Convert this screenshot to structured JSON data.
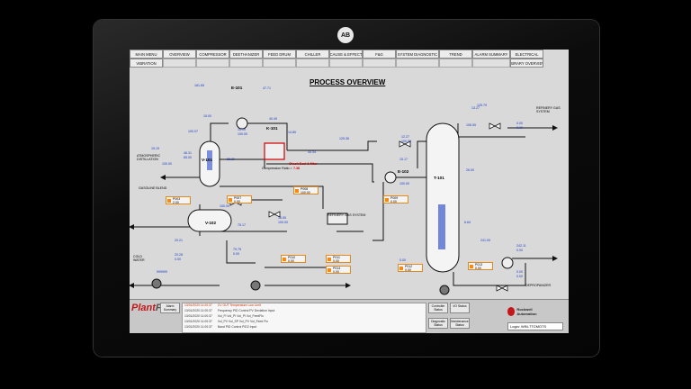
{
  "device": {
    "brand_logo_text": "AB"
  },
  "nav": {
    "row1": [
      "MAIN MENU",
      "OVERVIEW",
      "COMPRESSOR",
      "DEETHANIZER",
      "FEED DRUM",
      "CHILLER",
      "CAUSE & EFFECT",
      "F&G",
      "SYSTEM DIAGNOSTIC",
      "TREND",
      "ALARM SUMMARY",
      "ELECTRICAL"
    ],
    "row2_left": "VIBRATION",
    "row2_right": "LIBRARY OVERVIEW"
  },
  "page_title": "PROCESS OVERVIEW",
  "equipment": {
    "e101": "E-101",
    "k101": "K-101",
    "v101": "V-101",
    "v102": "V-102",
    "e102": "E-102",
    "t101": "T-101"
  },
  "streams": {
    "atmospheric": "ATMOSPHERIC DISTILLATION",
    "gasoline": "GASOLINE BLEND",
    "refinery_gas_top": "REFINERY GAS SYSTEM",
    "refinery_gas_mid": "REFINERY GAS SYSTEM",
    "cold_water": "COLD WATER",
    "depropanizer": "DEPROPANIZER"
  },
  "compressor": {
    "check_seal": "Check Seal & filter",
    "ratio_label": "Compression Ratio =",
    "ratio_value": "7.38"
  },
  "values": {
    "ti_top": "181.65",
    "tt_e101": "47.71",
    "pi_left": "15.00",
    "ti_left2": "100.07",
    "pv_v101": "10.19",
    "cv_v101": "100.00",
    "fi_k101": "40.49",
    "pt_k101": "14.85",
    "fi_atm": "15.19",
    "ti_atm": "100.00",
    "fi_flow": "125.36",
    "ti_flow2": "44.34",
    "lt_v101": "65.29",
    "pv_lic": "46.31",
    "cv_lic": "65.00",
    "pv_t101a": "12.27",
    "cv_t101a": "100.00",
    "ti_t101": "106.55",
    "pi_t101": "15.17",
    "pv_t101b": "100.00",
    "ti_t101c": "26.00",
    "ri_top1": "13.27",
    "ri_top2": "125.79",
    "pv_top": "0.00",
    "cv_top": "0.00",
    "v102_temp": "20.21",
    "pv_v102": "20.28",
    "cv_v102": "0.00",
    "pv_mid": "16.55",
    "cv_mid": "100.00",
    "li_mid": "75.17",
    "pv_e102": "79.75",
    "cv_e102": "0.00",
    "cw_flow": "999999",
    "lt_t101": "6.64",
    "ti_bot": "241.00",
    "pv_bot": "242.11",
    "cv_bot": "0.00",
    "pi_bot": "0.00",
    "ti_bot2": "0.00",
    "tt_v102": "100.00",
    "pv_pump": "0.00",
    "cv_pump": "0.00"
  },
  "alarm_boxes": [
    {
      "tag": "P003",
      "val": "2.00"
    },
    {
      "tag": "P007",
      "val": "0.00"
    },
    {
      "tag": "P008",
      "val": "100.00"
    },
    {
      "tag": "P009",
      "val": "0.00"
    },
    {
      "tag": "P010",
      "val": "0.00"
    },
    {
      "tag": "P011",
      "val": "0.00"
    },
    {
      "tag": "P012",
      "val": "0.00"
    },
    {
      "tag": "P013",
      "val": "0.00"
    },
    {
      "tag": "P014",
      "val": "0.00"
    }
  ],
  "bottom": {
    "brand": "Plant",
    "brand2": "PAx",
    "alarm_rows": [
      {
        "time": "13/01/2020 11:00:37",
        "text": "CV OUT Temperature Low Limit",
        "hi": true
      },
      {
        "time": "13/01/2020 11:00:37",
        "text": "Frequency PID Control PV Deviation Input",
        "hi": false
      },
      {
        "time": "13/01/2020 11:00:37",
        "text": "Vol_FI Vol_PI Vol_PI Vol_FeedFlo",
        "hi": false
      },
      {
        "time": "13/01/2020 11:00:37",
        "text": "Vol_PV Vol_SP Vol_PV Vol_Feed Flo",
        "hi": false
      },
      {
        "time": "13/01/2020 11:00:37",
        "text": "Band PID Control PID2 Input",
        "hi": false
      }
    ],
    "buttons": [
      "Alarm Summary",
      "Controller Status",
      "I/O Status",
      "Diagnostic Status",
      "Maintenance Status"
    ],
    "ra_name": "Rockwell Automation",
    "login": "Login: WIN-7TCMO7S"
  }
}
